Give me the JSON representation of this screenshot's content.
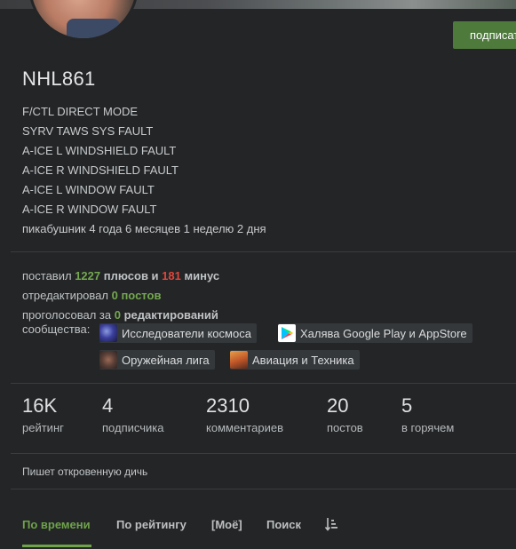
{
  "profile": {
    "subscribe_label": "подписаться",
    "username": "NHL861",
    "bio_lines": [
      "F/CTL DIRECT MODE",
      "SYRV TAWS SYS FAULT",
      "A-ICE L WINDSHIELD FAULT",
      "A-ICE R WINDSHIELD FAULT",
      "A-ICE L WINDOW FAULT",
      "A-ICE R WINDOW FAULT",
      "пикабушник 4 года 6 месяцев 1 неделю 2 дня"
    ]
  },
  "activity": {
    "put_prefix": "поставил",
    "plus_count": "1227",
    "plus_label": "плюсов и",
    "minus_count": "181",
    "minus_label": "минус",
    "edited_prefix": "отредактировал",
    "edited_value": "0 постов",
    "voted_prefix": "проголосовал за",
    "voted_count": "0",
    "voted_label": "редактирований",
    "communities_label": "сообщества:",
    "communities": [
      {
        "name": "Исследователи космоса",
        "icon": "space-icon"
      },
      {
        "name": "Халява Google Play и AppStore",
        "icon": "google-play-icon"
      },
      {
        "name": "Оружейная лига",
        "icon": "gun-icon"
      },
      {
        "name": "Авиация и Техника",
        "icon": "aviation-icon"
      }
    ]
  },
  "stats": [
    {
      "value": "16K",
      "label": "рейтинг"
    },
    {
      "value": "4",
      "label": "подписчика"
    },
    {
      "value": "2310",
      "label": "комментариев"
    },
    {
      "value": "20",
      "label": "постов"
    },
    {
      "value": "5",
      "label": "в горячем"
    }
  ],
  "about": "Пишет откровенную дичь",
  "tabs": [
    {
      "label": "По времени",
      "active": true
    },
    {
      "label": "По рейтингу",
      "active": false
    },
    {
      "label": "[Моё]",
      "active": false
    },
    {
      "label": "Поиск",
      "active": false
    }
  ],
  "colors": {
    "accent_green": "#6fa34a",
    "minus_red": "#e0463a",
    "background": "#232527"
  }
}
